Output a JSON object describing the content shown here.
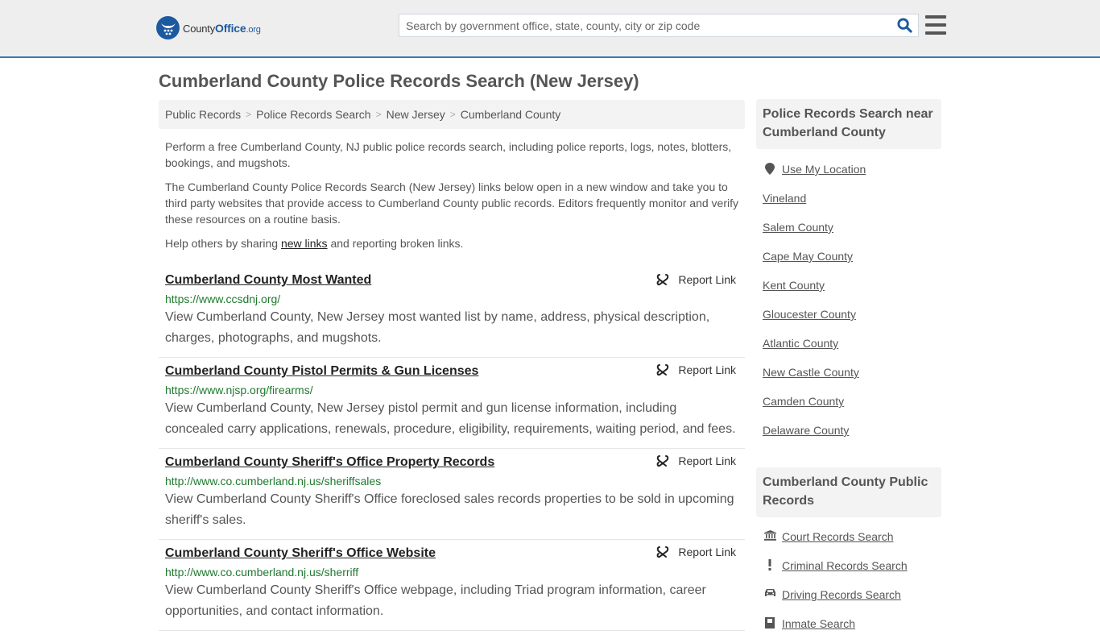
{
  "header": {
    "logo": {
      "brand_prefix": "County",
      "brand_main": "Office",
      "brand_suffix": ".org",
      "icon": "eagle-stars-logo-icon"
    },
    "search": {
      "placeholder": "Search by government office, state, county, city or zip code",
      "value": "",
      "button_icon": "search-icon"
    },
    "menu_icon": "hamburger-menu-icon"
  },
  "page": {
    "title": "Cumberland County Police Records Search (New Jersey)"
  },
  "breadcrumb": [
    "Public Records",
    "Police Records Search",
    "New Jersey",
    "Cumberland County"
  ],
  "intro": {
    "p1": "Perform a free Cumberland County, NJ public police records search, including police reports, logs, notes, blotters, bookings, and mugshots.",
    "p2": "The Cumberland County Police Records Search (New Jersey) links below open in a new window and take you to third party websites that provide access to Cumberland County public records. Editors frequently monitor and verify these resources on a routine basis.",
    "p3_before": "Help others by sharing ",
    "p3_link": "new links",
    "p3_after": " and reporting broken links."
  },
  "entries": [
    {
      "title": "Cumberland County Most Wanted",
      "url": "https://www.ccsdnj.org/",
      "description": "View Cumberland County, New Jersey most wanted list by name, address, physical description, charges, photographs, and mugshots.",
      "report_label": "Report Link"
    },
    {
      "title": "Cumberland County Pistol Permits & Gun Licenses",
      "url": "https://www.njsp.org/firearms/",
      "description": "View Cumberland County, New Jersey pistol permit and gun license information, including concealed carry applications, renewals, procedure, eligibility, requirements, waiting period, and fees.",
      "report_label": "Report Link"
    },
    {
      "title": "Cumberland County Sheriff's Office Property Records",
      "url": "http://www.co.cumberland.nj.us/sheriffsales",
      "description": "View Cumberland County Sheriff's Office foreclosed sales records properties to be sold in upcoming sheriff's sales.",
      "report_label": "Report Link"
    },
    {
      "title": "Cumberland County Sheriff's Office Website",
      "url": "http://www.co.cumberland.nj.us/sherriff",
      "description": "View Cumberland County Sheriff's Office webpage, including Triad program information, career opportunities, and contact information.",
      "report_label": "Report Link"
    }
  ],
  "sidebar": {
    "nearby": {
      "heading": "Police Records Search near Cumberland County",
      "use_location": "Use My Location",
      "items": [
        "Vineland",
        "Salem County",
        "Cape May County",
        "Kent County",
        "Gloucester County",
        "Atlantic County",
        "New Castle County",
        "Camden County",
        "Delaware County"
      ]
    },
    "public_records": {
      "heading": "Cumberland County Public Records",
      "items": [
        {
          "label": "Court Records Search",
          "icon": "courthouse-icon"
        },
        {
          "label": "Criminal Records Search",
          "icon": "exclamation-icon"
        },
        {
          "label": "Driving Records Search",
          "icon": "car-icon"
        },
        {
          "label": "Inmate Search",
          "icon": "inmate-icon"
        }
      ]
    }
  },
  "colors": {
    "brand": "#1c5aa0",
    "header_bg": "#eeeeee",
    "header_border": "#3a7bb0",
    "url_green": "#1f7a2e",
    "text": "#555555"
  }
}
